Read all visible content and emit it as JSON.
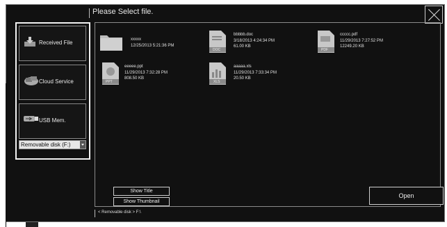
{
  "title": "Please Select file.",
  "sources": [
    {
      "label": "Received File",
      "icon": "received-file-icon"
    },
    {
      "label": "Cloud Service",
      "icon": "cloud-service-icon"
    },
    {
      "label": "USB Mem.",
      "icon": "usb-icon"
    }
  ],
  "drive_select": {
    "value": "Removable disk (F:)"
  },
  "files": [
    {
      "name": "xxxxx",
      "date": "12/25/2013 5:21:36 PM",
      "size": "",
      "icon": "folder-icon"
    },
    {
      "name": "bbbbb.doc",
      "date": "3/18/2013 4:24:34 PM",
      "size": "61.00 KB",
      "icon": "doc-icon",
      "badge": "DOC"
    },
    {
      "name": "ccccc.pdf",
      "date": "11/29/2013 7:27:52 PM",
      "size": "12249.20 KB",
      "icon": "pdf-icon",
      "badge": "PDF"
    },
    {
      "name": "eeeee.ppt",
      "date": "11/29/2013 7:32:28 PM",
      "size": "808.50 KB",
      "icon": "ppt-icon",
      "badge": "PPT"
    },
    {
      "name": "aaaaa.xls",
      "date": "11/29/2013 7:33:34 PM",
      "size": "20.50 KB",
      "icon": "xls-icon",
      "badge": "XLS"
    }
  ],
  "buttons": {
    "show_title": "Show Title",
    "show_thumbnail": "Show Thumbnail",
    "open": "Open"
  },
  "path": "< Removable disk > F:\\"
}
